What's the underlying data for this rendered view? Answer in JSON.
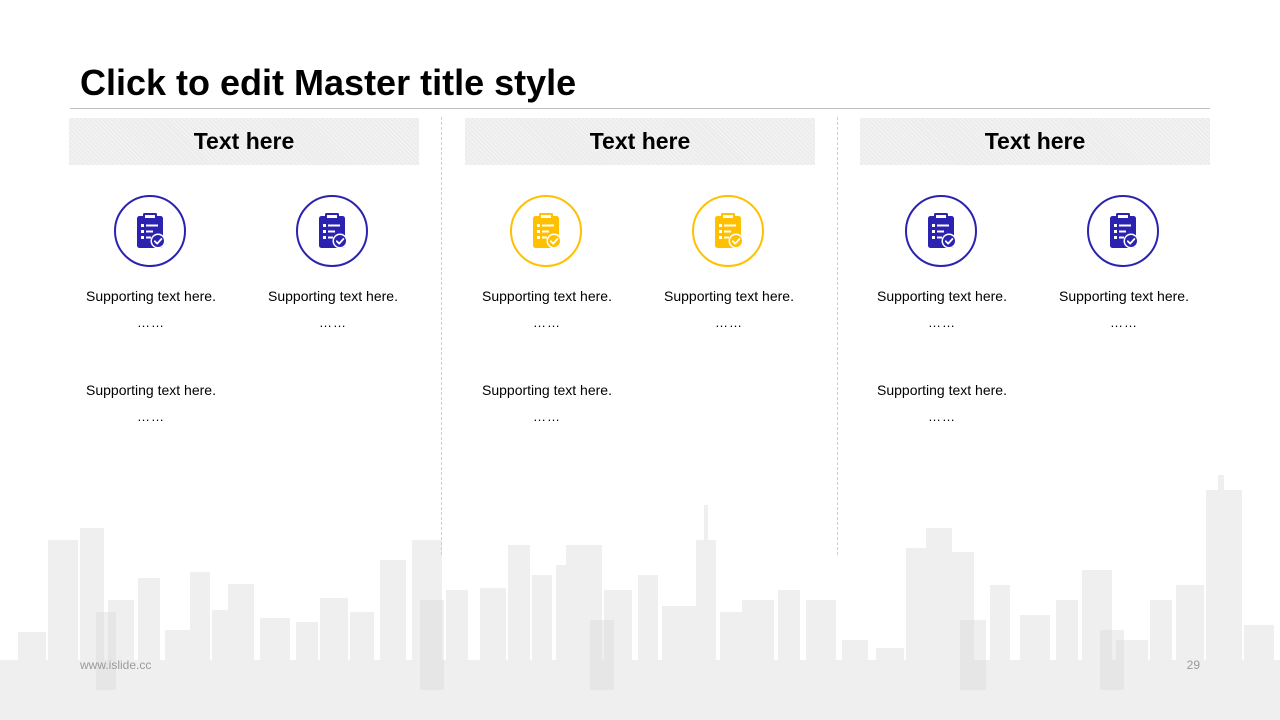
{
  "slide": {
    "title": "Click to edit Master title style",
    "footer_url": "www.islide.cc",
    "page_number": "29"
  },
  "colors": {
    "accent_blue": "#2B22B0",
    "accent_yellow": "#FFC000",
    "header_bg": "#ECECEC",
    "skyline": "#D9D9D9"
  },
  "columns": [
    {
      "header": "Text here",
      "icon": "clipboard-check-icon",
      "accent": "blue",
      "items": [
        {
          "text": "Supporting text here.",
          "dots": "……"
        },
        {
          "text": "Supporting text here.",
          "dots": "……"
        },
        {
          "text": "Supporting text here.",
          "dots": "……"
        }
      ]
    },
    {
      "header": "Text here",
      "icon": "clipboard-check-icon",
      "accent": "yellow",
      "items": [
        {
          "text": "Supporting text here.",
          "dots": "……"
        },
        {
          "text": "Supporting text here.",
          "dots": "……"
        },
        {
          "text": "Supporting text here.",
          "dots": "……"
        }
      ]
    },
    {
      "header": "Text here",
      "icon": "clipboard-check-icon",
      "accent": "blue",
      "items": [
        {
          "text": "Supporting text here.",
          "dots": "……"
        },
        {
          "text": "Supporting text here.",
          "dots": "……"
        },
        {
          "text": "Supporting text here.",
          "dots": "……"
        }
      ]
    }
  ]
}
